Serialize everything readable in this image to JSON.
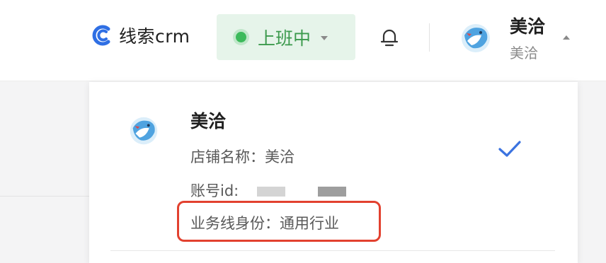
{
  "header": {
    "brand_name": "线索crm",
    "work_status": "上班中",
    "user_name": "美洽",
    "user_sub": "美洽"
  },
  "account_menu": {
    "account": {
      "name": "美洽",
      "shop_label": "店铺名称：",
      "shop_name": "美洽",
      "id_label": "账号id:",
      "business_label": "业务线身份：",
      "business_value": "通用行业"
    }
  },
  "colors": {
    "brand_blue": "#2f6fe4",
    "status_green": "#3cba5b",
    "status_bg": "#e6f4ea",
    "check_blue": "#3b73e0",
    "highlight_red": "#e2412f"
  },
  "icons": [
    "brand-logo-icon",
    "status-dot-icon",
    "bell-icon",
    "avatar-icon",
    "checkmark-icon"
  ]
}
